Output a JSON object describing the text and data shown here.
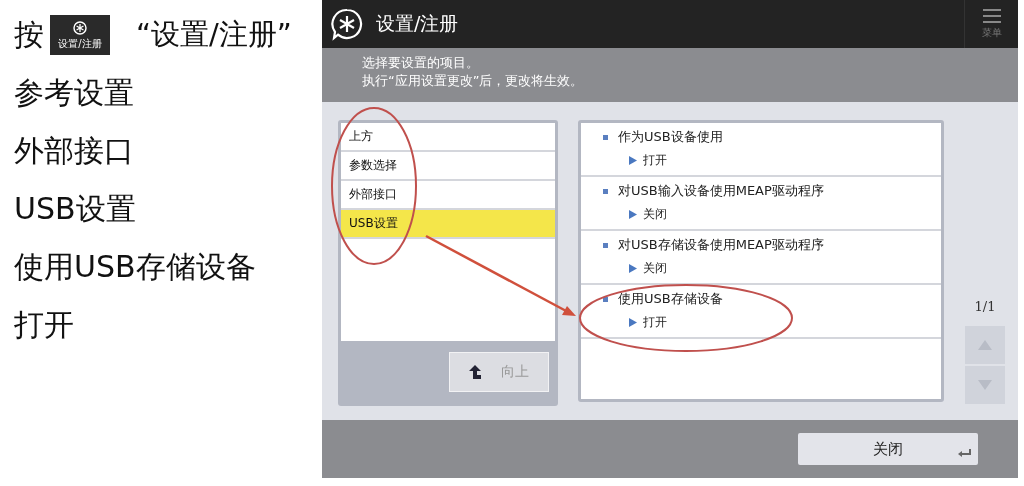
{
  "steps": [
    {
      "kind": "button_step",
      "label": "按",
      "icon_caption": "设置/注册",
      "text": "“设置/注册”"
    },
    {
      "kind": "text",
      "text": "参考设置"
    },
    {
      "kind": "text",
      "text": "外部接口"
    },
    {
      "kind": "text",
      "text": "USB设置"
    },
    {
      "kind": "text",
      "text": "使用USB存储设备"
    },
    {
      "kind": "text",
      "text": "打开"
    }
  ],
  "screen": {
    "title": "设置/注册",
    "menu_label": "菜单",
    "message": [
      "选择要设置的项目。",
      "执行“应用设置更改”后，更改将生效。"
    ],
    "categories": [
      {
        "label": "上方",
        "selected": false
      },
      {
        "label": "参数选择",
        "selected": false
      },
      {
        "label": "外部接口",
        "selected": false
      },
      {
        "label": "USB设置",
        "selected": true
      }
    ],
    "up_button": "向上",
    "settings": [
      {
        "name": "作为USB设备使用",
        "value": "打开"
      },
      {
        "name": "对USB输入设备使用MEAP驱动程序",
        "value": "关闭"
      },
      {
        "name": "对USB存储设备使用MEAP驱动程序",
        "value": "关闭"
      },
      {
        "name": "使用USB存储设备",
        "value": "打开"
      }
    ],
    "page": "1/1",
    "scroll_up_disabled": true,
    "scroll_down_disabled": true,
    "close_button": "关闭"
  }
}
